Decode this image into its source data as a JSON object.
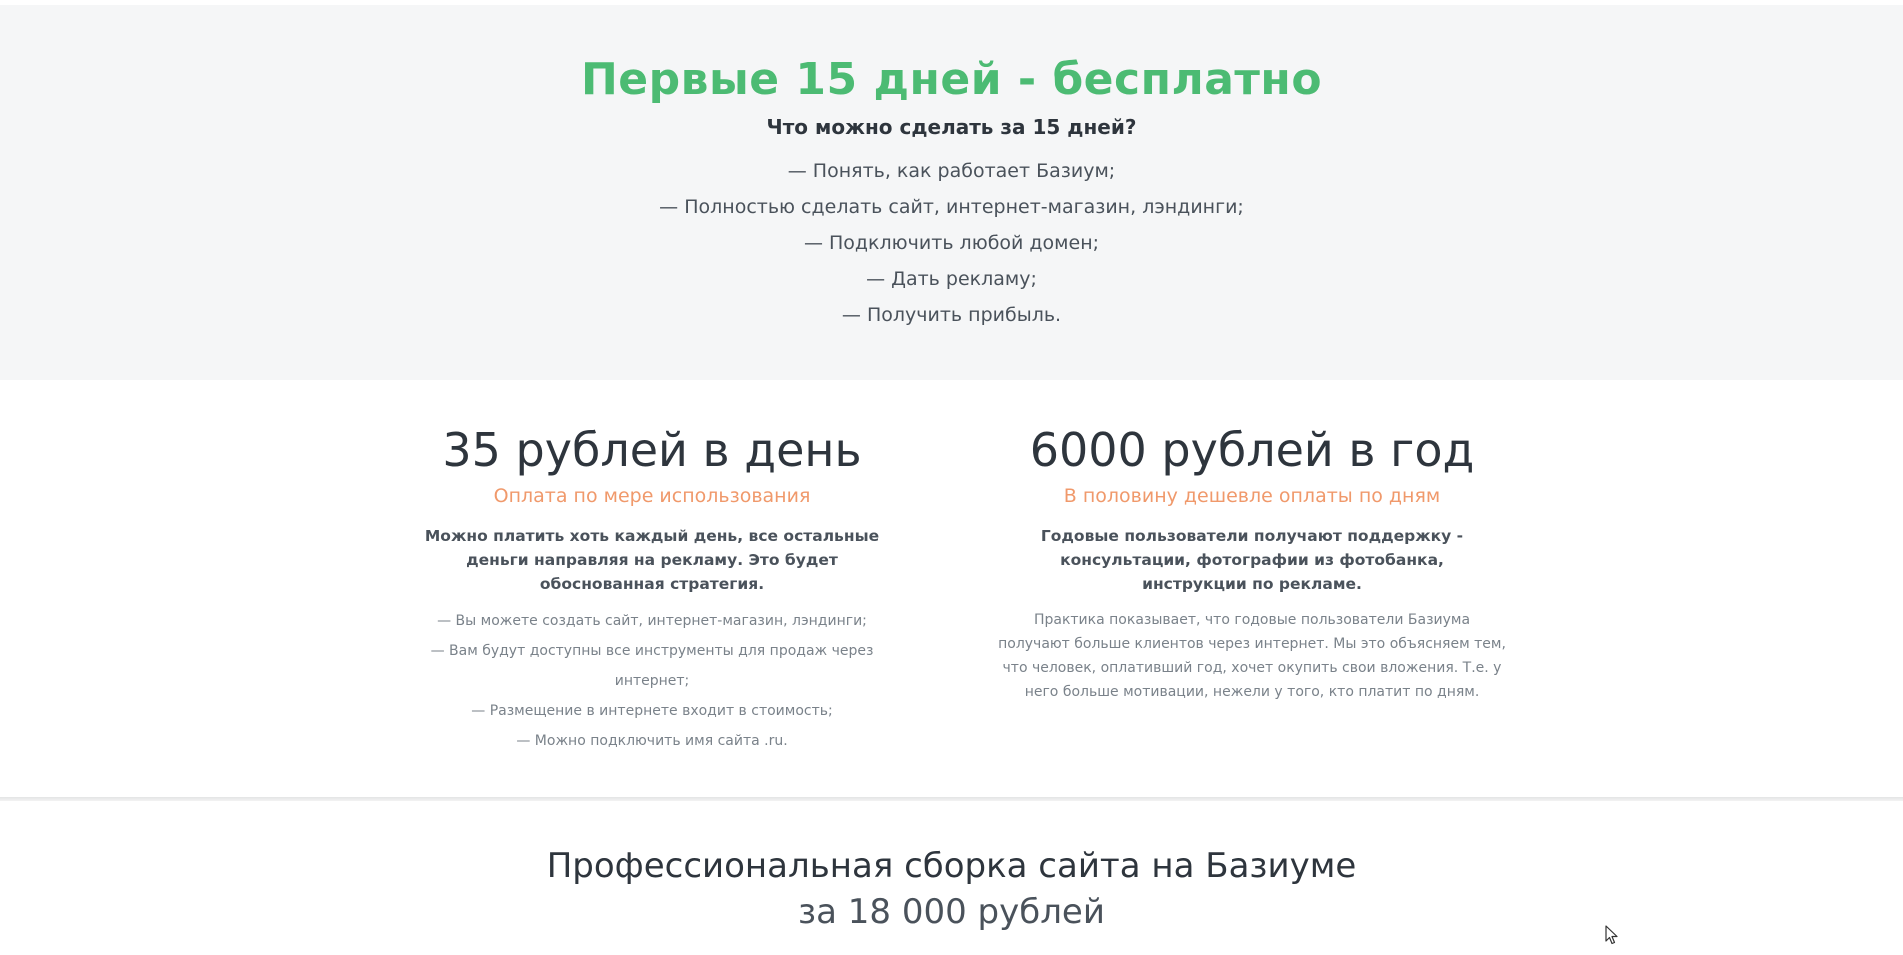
{
  "free_trial": {
    "title": "Первые 15 дней - бесплатно",
    "subtitle": "Что можно сделать за 15 дней?",
    "items": [
      "— Понять, как работает Базиум;",
      "— Полностью сделать сайт, интернет-магазин, лэндинги;",
      "— Подключить любой домен;",
      "— Дать рекламу;",
      "— Получить прибыль."
    ],
    "accent_color": "#4cbb73"
  },
  "plans": {
    "daily": {
      "title": "35 рублей в день",
      "subtitle": "Оплата по мере использования",
      "lead": "Можно платить хоть каждый день, все остальные деньги направляя на рекламу. Это будет обоснованная стратегия.",
      "items": [
        "— Вы можете создать сайт, интернет-магазин, лэндинги;",
        "— Вам будут доступны все инструменты для продаж через интернет;",
        "— Размещение в интернете входит в стоимость;",
        "— Можно подключить имя сайта .ru."
      ]
    },
    "yearly": {
      "title": "6000 рублей в год",
      "subtitle": "В половину дешевле оплаты по дням",
      "lead": "Годовые пользователи получают поддержку - консультации, фотографии из фотобанка, инструкции по рекламе.",
      "text": "Практика показывает, что годовые пользователи Базиума получают больше клиентов через интернет. Мы это объясняем тем, что человек, оплативший год, хочет окупить свои вложения. Т.е. у него больше мотивации, нежели у того, кто платит по дням."
    },
    "subtitle_color": "#f0996b"
  },
  "assembly": {
    "title": "Профессиональная сборка сайта на Базиуме",
    "price": "за 18 000 рублей"
  },
  "icons": {
    "cursor": "mouse-pointer-icon"
  }
}
